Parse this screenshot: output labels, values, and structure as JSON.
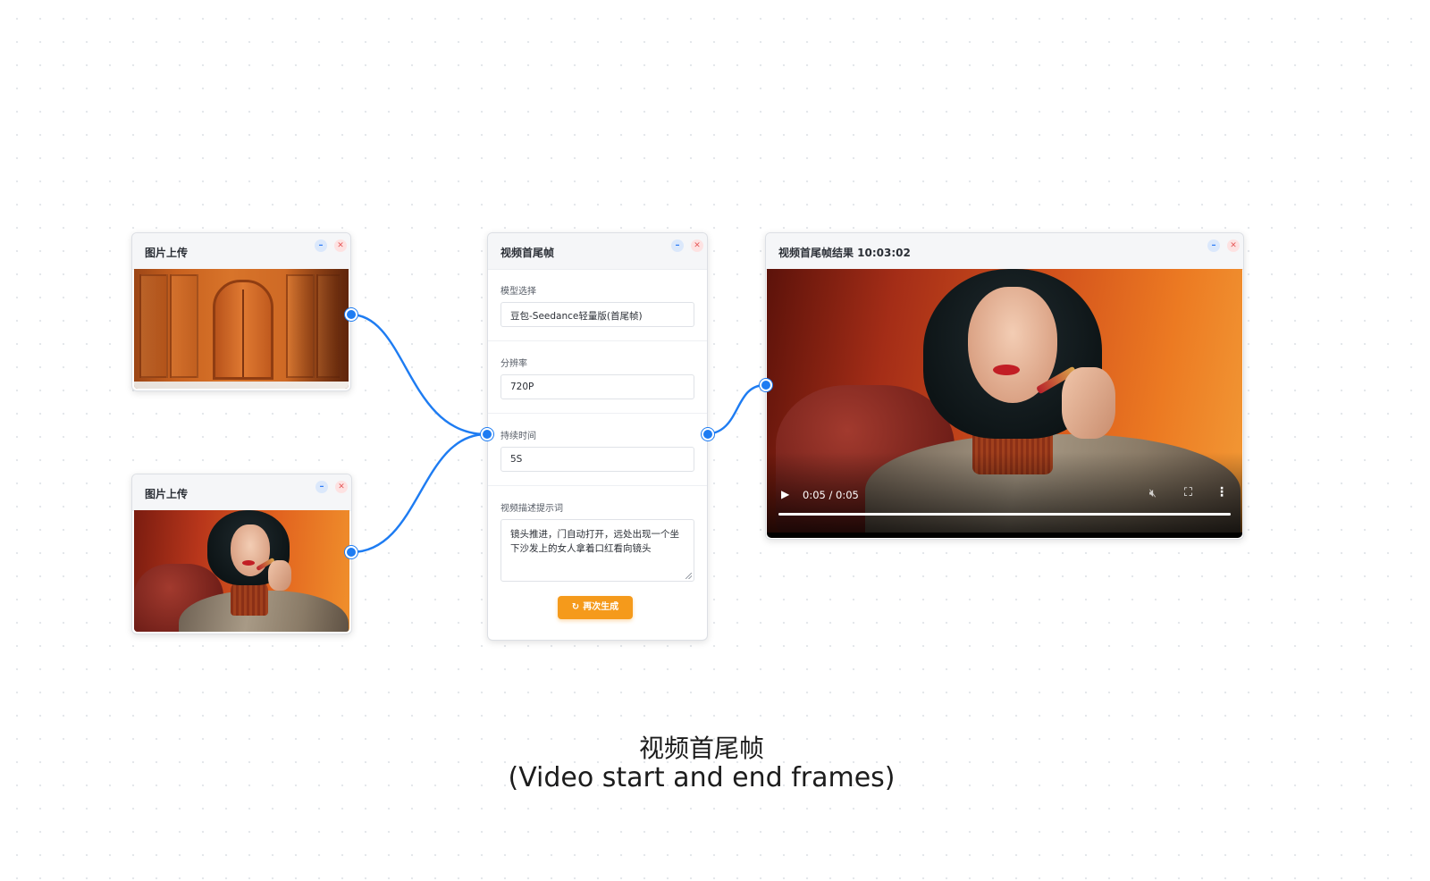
{
  "nodes": {
    "upload_top": {
      "title": "图片上传"
    },
    "upload_bottom": {
      "title": "图片上传"
    },
    "frames": {
      "title": "视频首尾帧",
      "model_label": "模型选择",
      "model_value": "豆包-Seedance轻量版(首尾帧)",
      "resolution_label": "分辨率",
      "resolution_value": "720P",
      "duration_label": "持续时间",
      "duration_value": "5S",
      "prompt_label": "视频描述提示词",
      "prompt_value": "镜头推进，门自动打开，远处出现一个坐下沙发上的女人拿着口红看向镜头",
      "regen_label": "再次生成"
    },
    "result": {
      "title": "视频首尾帧结果 10:03:02",
      "time_display": "0:05 / 0:05",
      "progress_fraction": 1.0
    }
  },
  "caption": {
    "cn": "视频首尾帧",
    "en": "(Video start and end frames)"
  },
  "icons": {
    "minimize": "minus-icon",
    "close": "close-icon",
    "play": "play-icon",
    "mute": "mute-icon",
    "fullscreen": "fullscreen-icon",
    "more": "more-vertical-icon",
    "regenerate": "refresh-icon"
  },
  "colors": {
    "accent": "#1e7cf2",
    "button": "#f59a1b"
  }
}
